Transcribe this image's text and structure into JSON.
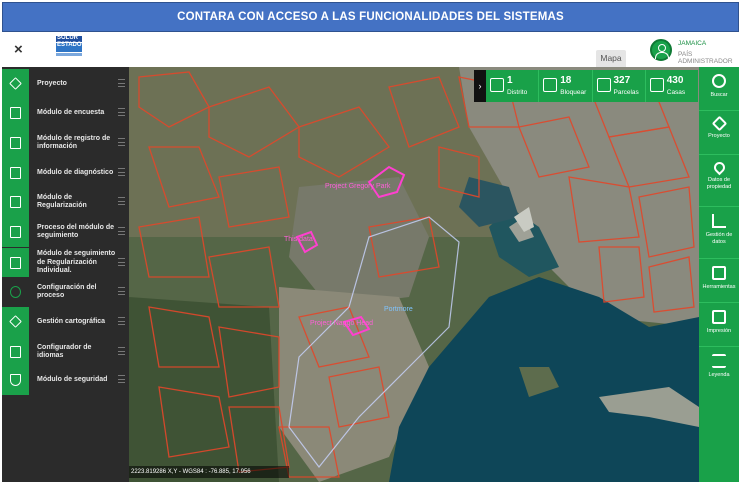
{
  "banner": {
    "title": "CONTARA CON ACCESO A LAS FUNCIONALIDADES DEL SISTEMAS"
  },
  "header": {
    "close_glyph": "×",
    "logo_text": "SOLUR ESTADO",
    "active_tab": "Mapa",
    "user_name": "JAMAICA",
    "user_role": "PAÍS ADMINISTRADOR"
  },
  "sidebar": {
    "items": [
      {
        "label": "Proyecto",
        "icon": "layers-icon"
      },
      {
        "label": "Módulo de encuesta",
        "icon": "book-icon"
      },
      {
        "label": "Módulo de registro de información",
        "icon": "document-icon"
      },
      {
        "label": "Módulo de diagnóstico",
        "icon": "diagnostic-icon"
      },
      {
        "label": "Módulo de Regularización",
        "icon": "regularization-icon"
      },
      {
        "label": "Proceso del módulo de seguimiento",
        "icon": "tracking-icon"
      },
      {
        "label": "Módulo de seguimiento de Regularización Individual.",
        "icon": "individual-tracking-icon"
      },
      {
        "label": "Configuración del proceso",
        "icon": "gear-icon"
      },
      {
        "label": "Gestión cartográfica",
        "icon": "layers-icon"
      },
      {
        "label": "Configurador de idiomas",
        "icon": "language-icon"
      },
      {
        "label": "Módulo de seguridad",
        "icon": "shield-icon"
      }
    ]
  },
  "stats": [
    {
      "value": "1",
      "label": "Distrito",
      "icon": "district-map-icon"
    },
    {
      "value": "18",
      "label": "Bloquear",
      "icon": "grid-block-icon"
    },
    {
      "value": "327",
      "label": "Parcelas",
      "icon": "parcel-house-icon"
    },
    {
      "value": "430",
      "label": "Casas",
      "icon": "buildings-icon"
    }
  ],
  "stats_toggle": "›",
  "map": {
    "labels": {
      "project_gregory": "Project Gregory Park",
      "this_data": "This data",
      "portmore": "Portmore",
      "project_naggo": "Project Naggo Head"
    },
    "coords": "2223.819286 X,Y - WGS84 : -76.885, 17.956"
  },
  "toolbar": [
    {
      "label": "Buscar",
      "icon": "search-icon"
    },
    {
      "label": "Proyecto",
      "icon": "layers-icon"
    },
    {
      "label": "Datos de propiedad",
      "icon": "map-pin-icon"
    },
    {
      "label": "Gestión de datos",
      "icon": "bar-chart-icon"
    },
    {
      "label": "Herramientas",
      "icon": "toolbox-icon"
    },
    {
      "label": "Impresión",
      "icon": "printer-icon"
    },
    {
      "label": "Leyenda",
      "icon": "list-icon"
    }
  ],
  "colors": {
    "accent": "#19a149",
    "banner": "#4472c4",
    "sidebar_bg": "#2b2b2b",
    "parcel_outline": "#e2472a",
    "project_highlight": "#ff3fd0"
  }
}
